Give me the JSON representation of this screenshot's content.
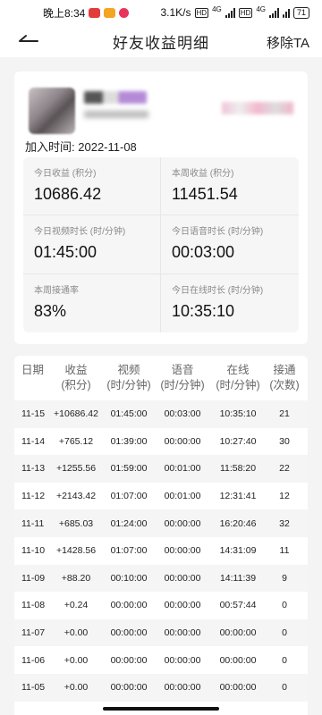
{
  "status_bar": {
    "time": "晚上8:34",
    "network_speed": "3.1K/s",
    "battery": "71",
    "signal_1": "4G",
    "signal_2": "4G",
    "hd_1": "HD",
    "hd_2": "HD",
    "app_icon_colors": [
      "#e23b3b",
      "#f2a623",
      "#e8335a"
    ]
  },
  "nav": {
    "title": "好友收益明细",
    "action": "移除TA",
    "back_icon": "back-arrow-icon"
  },
  "profile": {
    "join_label": "加入时间:",
    "join_date": "2022-11-08",
    "stats": [
      {
        "label": "今日收益 (积分)",
        "value": "10686.42"
      },
      {
        "label": "本周收益 (积分)",
        "value": "11451.54"
      },
      {
        "label": "今日视频时长 (时/分钟)",
        "value": "01:45:00"
      },
      {
        "label": "今日语音时长 (时/分钟)",
        "value": "00:03:00"
      },
      {
        "label": "本周接通率",
        "value": "83%"
      },
      {
        "label": "今日在线时长 (时/分钟)",
        "value": "10:35:10"
      }
    ]
  },
  "table": {
    "headers": [
      {
        "line1": "日期",
        "line2": ""
      },
      {
        "line1": "收益",
        "line2": "(积分)"
      },
      {
        "line1": "视频",
        "line2": "(时/分钟)"
      },
      {
        "line1": "语音",
        "line2": "(时/分钟)"
      },
      {
        "line1": "在线",
        "line2": "(时/分钟)"
      },
      {
        "line1": "接通",
        "line2": "(次数)"
      }
    ],
    "rows": [
      [
        "11-15",
        "+10686.42",
        "01:45:00",
        "00:03:00",
        "10:35:10",
        "21"
      ],
      [
        "11-14",
        "+765.12",
        "01:39:00",
        "00:00:00",
        "10:27:40",
        "30"
      ],
      [
        "11-13",
        "+1255.56",
        "01:59:00",
        "00:01:00",
        "11:58:20",
        "22"
      ],
      [
        "11-12",
        "+2143.42",
        "01:07:00",
        "00:01:00",
        "12:31:41",
        "12"
      ],
      [
        "11-11",
        "+685.03",
        "01:24:00",
        "00:00:00",
        "16:20:46",
        "32"
      ],
      [
        "11-10",
        "+1428.56",
        "01:07:00",
        "00:00:00",
        "14:31:09",
        "11"
      ],
      [
        "11-09",
        "+88.20",
        "00:10:00",
        "00:00:00",
        "14:11:39",
        "9"
      ],
      [
        "11-08",
        "+0.24",
        "00:00:00",
        "00:00:00",
        "00:57:44",
        "0"
      ],
      [
        "11-07",
        "+0.00",
        "00:00:00",
        "00:00:00",
        "00:00:00",
        "0"
      ],
      [
        "11-06",
        "+0.00",
        "00:00:00",
        "00:00:00",
        "00:00:00",
        "0"
      ],
      [
        "11-05",
        "+0.00",
        "00:00:00",
        "00:00:00",
        "00:00:00",
        "0"
      ]
    ]
  }
}
